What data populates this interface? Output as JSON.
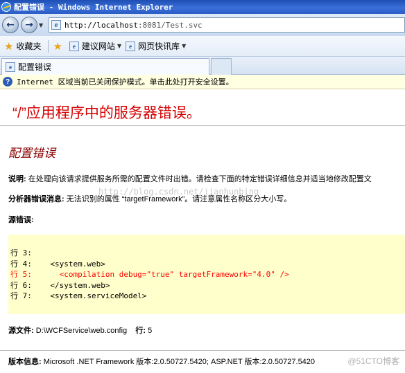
{
  "window": {
    "title": "配置错误 - Windows Internet Explorer",
    "icon": "ie-logo-icon"
  },
  "nav": {
    "back_icon": "back-arrow-icon",
    "forward_icon": "forward-arrow-icon",
    "address_host": "http://localhost",
    "address_rest": ":8081/Test.svc"
  },
  "favorites_bar": {
    "favorites_label": "收藏夹",
    "items": [
      {
        "label": "建议网站",
        "icon": "ie-page-icon"
      },
      {
        "label": "网页快讯库",
        "icon": "ie-page-icon"
      }
    ]
  },
  "tabs": [
    {
      "label": "配置错误",
      "active": true
    }
  ],
  "infobar": {
    "text": "Internet 区域当前已关闭保护模式。单击此处打开安全设置。",
    "icon": "info-shield-icon"
  },
  "page": {
    "server_error_title": "“/”应用程序中的服务器错误。",
    "error_title": "配置错误",
    "description_label": "说明:",
    "description_text": " 在处理向该请求提供服务所需的配置文件时出错。请检查下面的特定错误详细信息并适当地修改配置文",
    "parser_label": "分析器错误消息:",
    "parser_text": " 无法识别的属性 “targetFramework”。请注意属性名称区分大小写。",
    "source_error_label": "源错误:",
    "code_lines": [
      {
        "text": "行 3:",
        "highlight": false
      },
      {
        "text": "行 4:    <system.web>",
        "highlight": false
      },
      {
        "text": "行 5:      <compilation debug=\"true\" targetFramework=\"4.0\" />",
        "highlight": true
      },
      {
        "text": "行 6:    </system.web>",
        "highlight": false
      },
      {
        "text": "行 7:    <system.serviceModel>",
        "highlight": false
      }
    ],
    "source_file_label": "源文件:",
    "source_file_value": " D:\\WCFService\\web.config",
    "line_label": "行:",
    "line_value": " 5",
    "version_label": "版本信息:",
    "version_value": " Microsoft .NET Framework 版本:2.0.50727.5420; ASP.NET 版本:2.0.50727.5420",
    "watermark": "http://blog.csdn.net/jianhunbing",
    "brand_watermark": "@51CTO博客"
  }
}
